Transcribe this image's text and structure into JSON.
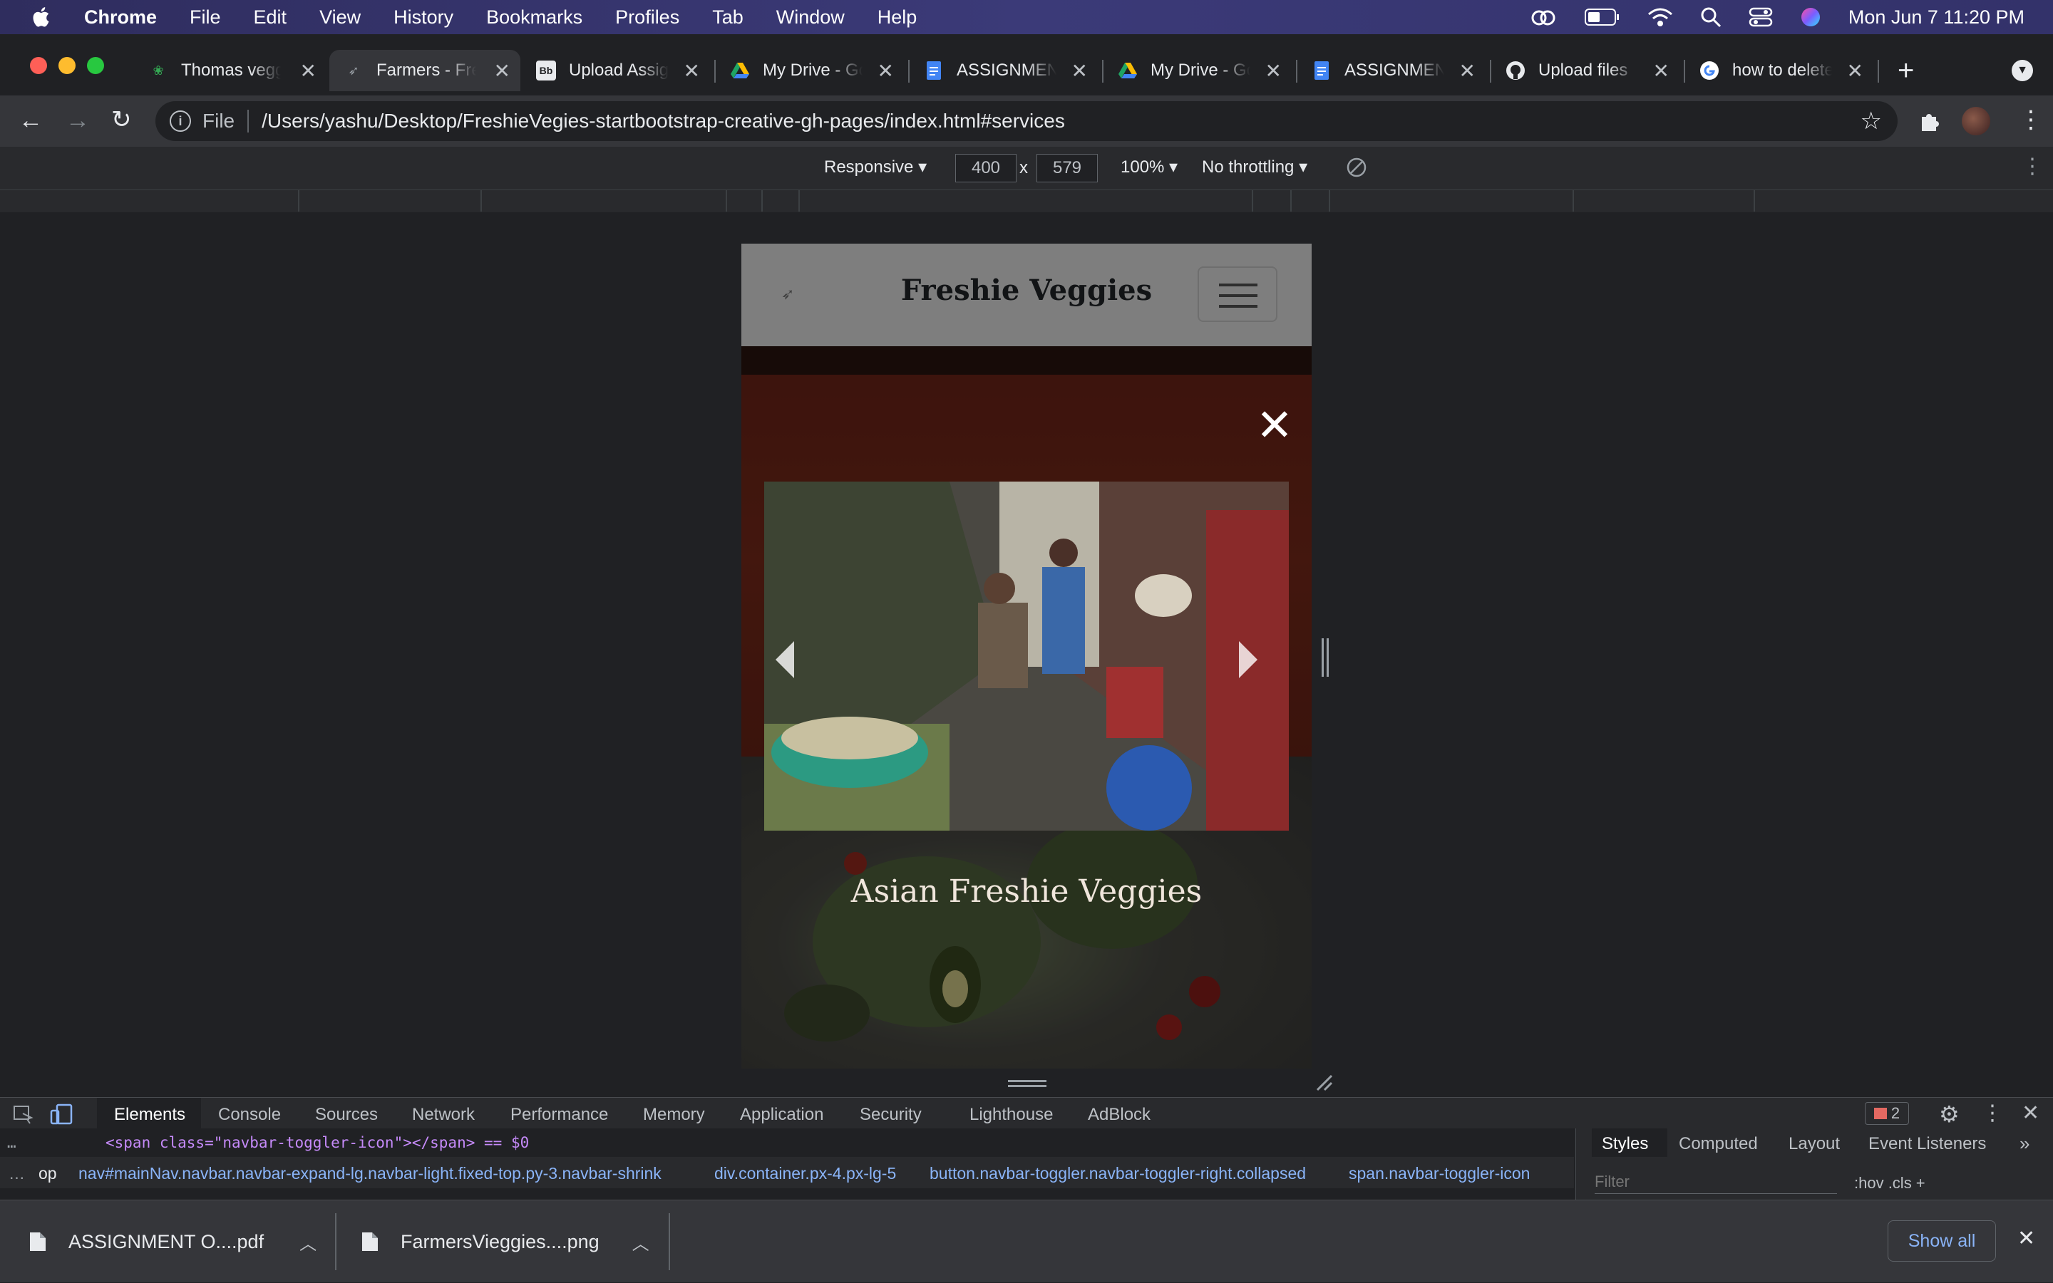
{
  "menubar": {
    "app": "Chrome",
    "items": [
      "File",
      "Edit",
      "View",
      "History",
      "Bookmarks",
      "Profiles",
      "Tab",
      "Window",
      "Help"
    ],
    "datetime": "Mon Jun 7  11:20 PM"
  },
  "tabs": [
    {
      "label": "Thomas veggies",
      "icon": "leaf-icon"
    },
    {
      "label": "Farmers - Freshie",
      "icon": "bird-icon"
    },
    {
      "label": "Upload Assignment",
      "icon": "bb-icon"
    },
    {
      "label": "My Drive - Google",
      "icon": "drive-icon"
    },
    {
      "label": "ASSIGNMENT",
      "icon": "docs-icon"
    },
    {
      "label": "My Drive - Google",
      "icon": "drive-icon"
    },
    {
      "label": "ASSIGNMENT",
      "icon": "docs-icon"
    },
    {
      "label": "Upload files",
      "icon": "github-icon"
    },
    {
      "label": "how to delete",
      "icon": "google-icon"
    }
  ],
  "omnibox": {
    "scheme_label": "File",
    "url": "/Users/yashu/Desktop/FreshieVegies-startbootstrap-creative-gh-pages/index.html#services"
  },
  "device_toolbar": {
    "mode": "Responsive ▾",
    "width": "400",
    "times": "x",
    "height": "579",
    "zoom": "100% ▾",
    "throttle": "No throttling ▾"
  },
  "site": {
    "brand": "Freshie Veggies",
    "lightbox_close": "✕",
    "caption": "Asian Freshie Veggies"
  },
  "devtools": {
    "tabs": [
      "Elements",
      "Console",
      "Sources",
      "Network",
      "Performance",
      "Memory",
      "Application",
      "Security",
      "Lighthouse",
      "AdBlock"
    ],
    "active_tab": "Elements",
    "issues_count": "2",
    "code_line": "<span class=\"navbar-toggler-icon\"></span> == $0",
    "crumbs": [
      "op",
      "nav#mainNav.navbar.navbar-expand-lg.navbar-light.fixed-top.py-3.navbar-shrink",
      "div.container.px-4.px-lg-5",
      "button.navbar-toggler.navbar-toggler-right.collapsed",
      "span.navbar-toggler-icon"
    ],
    "side_tabs": [
      "Styles",
      "Computed",
      "Layout",
      "Event Listeners"
    ],
    "filter_placeholder": "Filter",
    "filter_tools": ":hov  .cls  +"
  },
  "downloads": {
    "items": [
      "ASSIGNMENT O....pdf",
      "FarmersVieggies....png"
    ],
    "show_all": "Show all"
  },
  "colors": {
    "accent": "#8ab4f8",
    "brown": "#7a2a1b",
    "menubar": "#33326a"
  }
}
